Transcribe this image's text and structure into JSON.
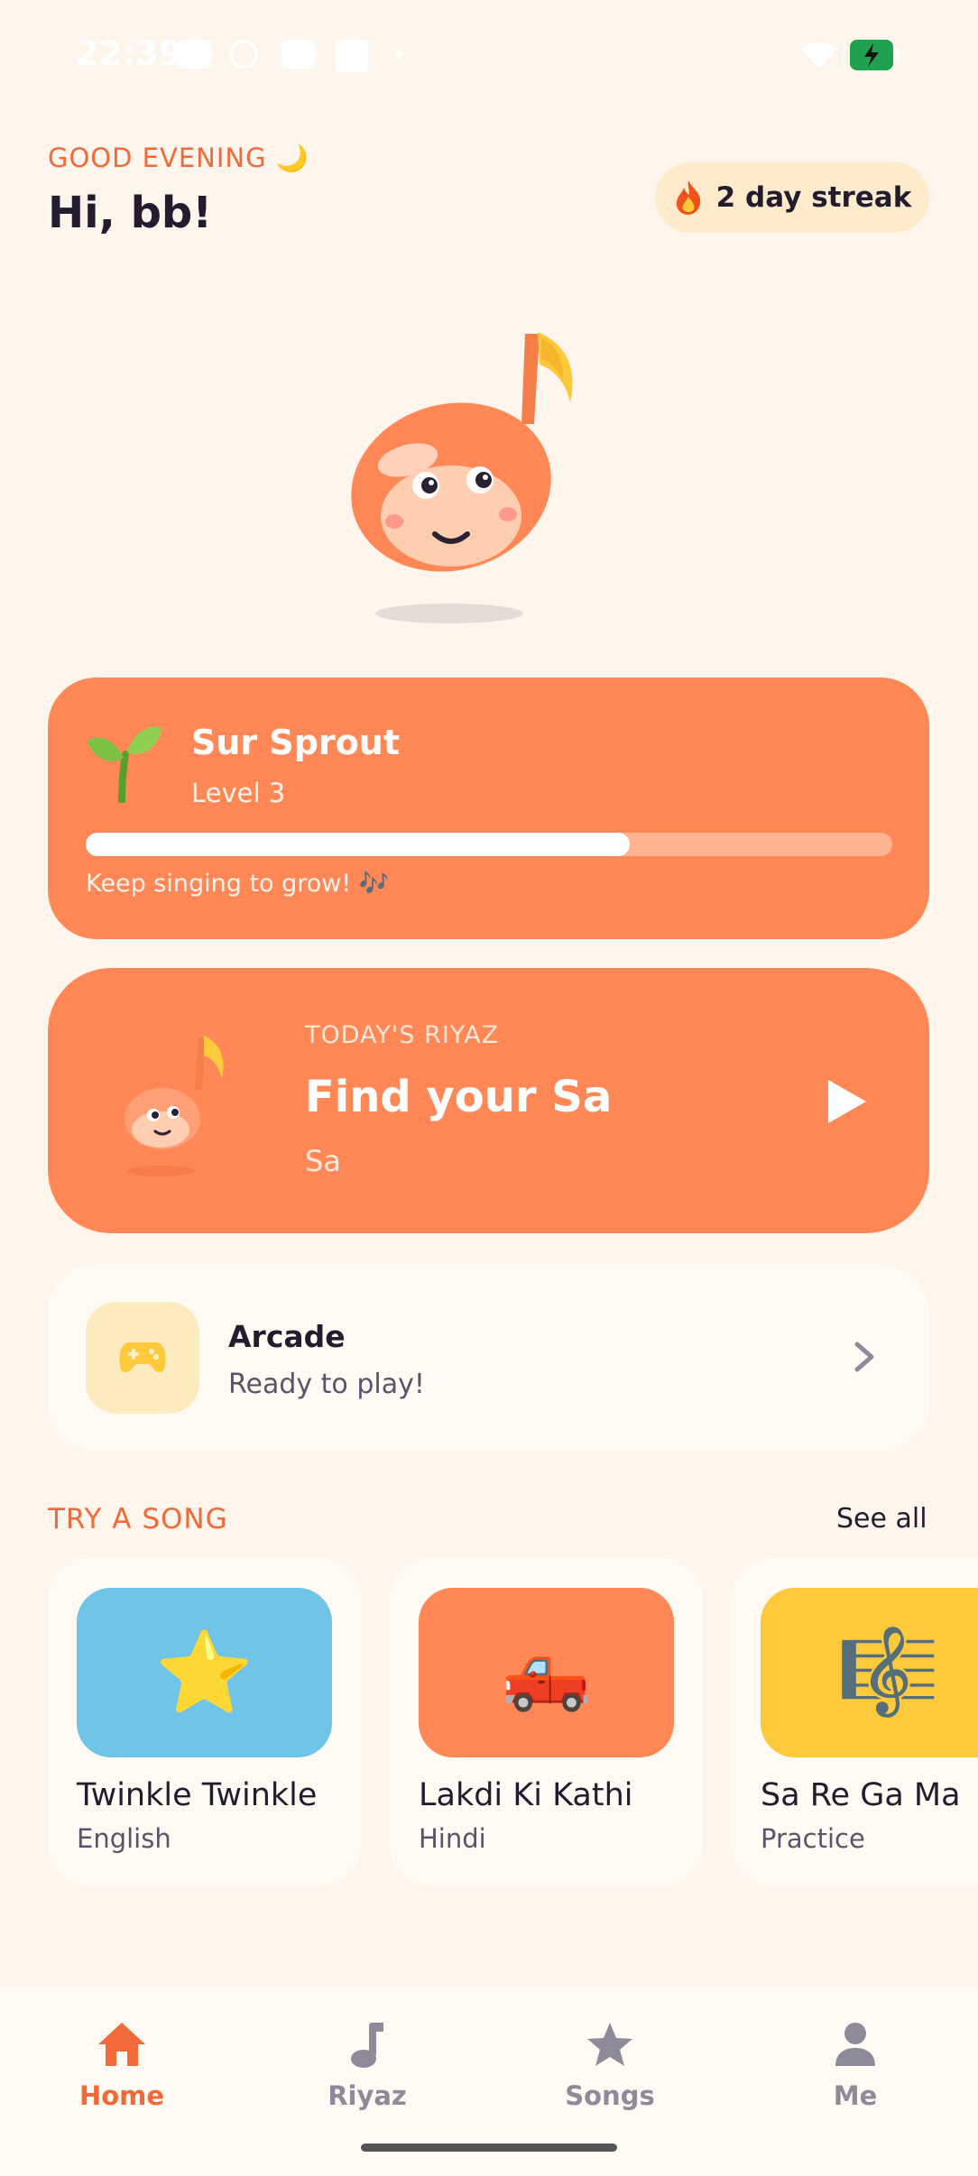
{
  "status_bar": {
    "time": "22:39"
  },
  "header": {
    "greeting": "GOOD EVENING 🌙",
    "name": "Hi, bb!"
  },
  "streak": {
    "icon": "flame-icon",
    "label": "2 day streak"
  },
  "level": {
    "icon": "sprout-icon",
    "title": "Sur Sprout",
    "subtitle": "Level 3",
    "progress_fraction": 0.675,
    "hint": "Keep singing to grow! 🎶"
  },
  "riyaz": {
    "label": "TODAY'S RIYAZ",
    "title": "Find your Sa",
    "note": "Sa",
    "action_icon": "play-icon"
  },
  "arcade": {
    "icon": "gamepad-icon",
    "title": "Arcade",
    "subtitle": "Ready to play!"
  },
  "songs_section": {
    "heading": "TRY A SONG",
    "see_all": "See all",
    "items": [
      {
        "title": "Twinkle Twinkle",
        "language": "English",
        "emoji": "⭐",
        "color": "#6FC4E8"
      },
      {
        "title": "Lakdi Ki Kathi",
        "language": "Hindi",
        "emoji": "🛻",
        "color": "#FF8856"
      },
      {
        "title": "Sa Re Ga Ma",
        "language": "Practice",
        "emoji": "🎼",
        "color": "#FFC93C"
      }
    ]
  },
  "nav": {
    "items": [
      {
        "label": "Home",
        "icon": "home-icon",
        "active": true
      },
      {
        "label": "Riyaz",
        "icon": "music-note-icon",
        "active": false
      },
      {
        "label": "Songs",
        "icon": "star-icon",
        "active": false
      },
      {
        "label": "Me",
        "icon": "person-icon",
        "active": false
      }
    ]
  },
  "colors": {
    "accent": "#FF8856",
    "accent_text": "#F26A3A",
    "background": "#FEF5EC"
  }
}
